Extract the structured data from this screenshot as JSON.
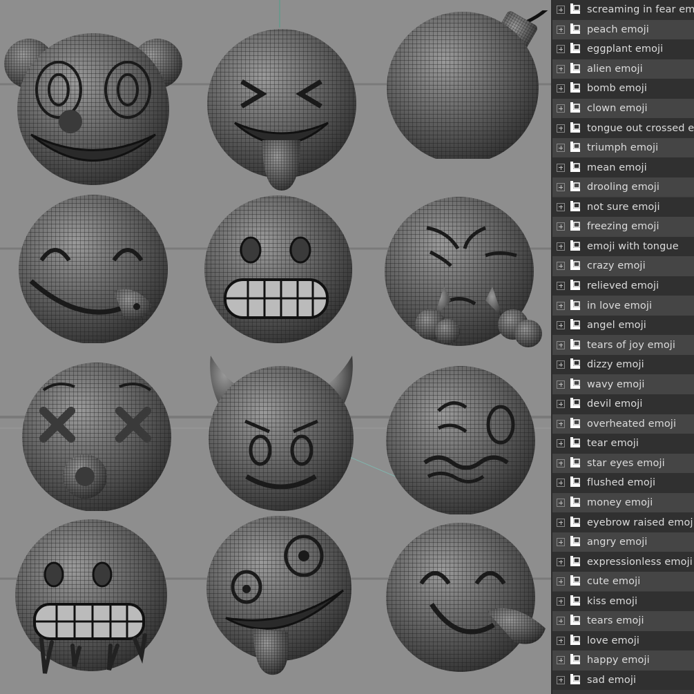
{
  "outliner": {
    "items": [
      {
        "label": "screaming in fear emoji"
      },
      {
        "label": "peach emoji"
      },
      {
        "label": "eggplant emoji"
      },
      {
        "label": "alien emoji"
      },
      {
        "label": "bomb emoji"
      },
      {
        "label": "clown emoji"
      },
      {
        "label": "tongue out crossed eyes emoji"
      },
      {
        "label": "triumph emoji"
      },
      {
        "label": "mean emoji"
      },
      {
        "label": "drooling emoji"
      },
      {
        "label": "not sure emoji"
      },
      {
        "label": "freezing emoji"
      },
      {
        "label": "emoji with tongue"
      },
      {
        "label": "crazy emoji"
      },
      {
        "label": "relieved emoji"
      },
      {
        "label": "in love emoji"
      },
      {
        "label": "angel emoji"
      },
      {
        "label": "tears of joy emoji"
      },
      {
        "label": "dizzy emoji"
      },
      {
        "label": "wavy emoji"
      },
      {
        "label": "devil emoji"
      },
      {
        "label": "overheated emoji"
      },
      {
        "label": "tear emoji"
      },
      {
        "label": "star eyes emoji"
      },
      {
        "label": "flushed emoji"
      },
      {
        "label": "money emoji"
      },
      {
        "label": "eyebrow raised emoji"
      },
      {
        "label": "angry emoji"
      },
      {
        "label": "expressionless emoji"
      },
      {
        "label": "cute emoji"
      },
      {
        "label": "kiss emoji"
      },
      {
        "label": "tears emoji"
      },
      {
        "label": "love emoji"
      },
      {
        "label": "happy emoji"
      },
      {
        "label": "sad emoji"
      }
    ],
    "node_icon": "mesh-node-icon",
    "expand_icon": "expand-plus-icon"
  },
  "viewport": {
    "models": [
      "clown",
      "tongue-out-crossed-eyes",
      "bomb",
      "drooling",
      "grimace",
      "triumph",
      "dizzy",
      "devil",
      "wavy",
      "freezing",
      "crazy",
      "tongue-side"
    ]
  },
  "colors": {
    "viewport_bg": "#8e8e8e",
    "mesh_face": "#5a5a5a",
    "mesh_wire": "#1e1e1e",
    "outliner_bg": "#3a3a3a",
    "outliner_text": "#dcdcdc"
  }
}
